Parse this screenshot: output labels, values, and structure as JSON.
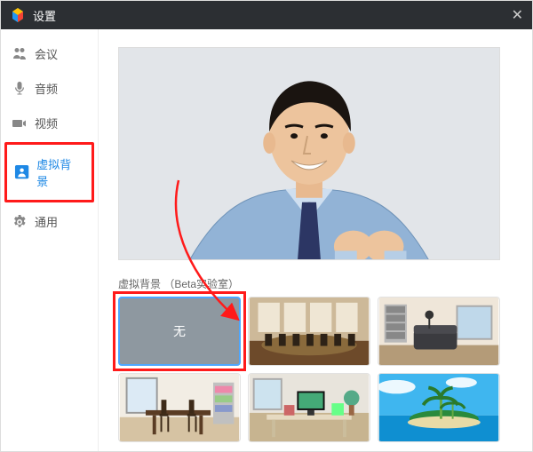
{
  "titlebar": {
    "title": "设置"
  },
  "sidebar": {
    "items": [
      {
        "label": "会议"
      },
      {
        "label": "音频"
      },
      {
        "label": "视频"
      },
      {
        "label": "虚拟背景"
      },
      {
        "label": "通用"
      }
    ]
  },
  "main": {
    "section_label": "虚拟背景 （Beta实验室）",
    "bg_none_label": "无"
  }
}
